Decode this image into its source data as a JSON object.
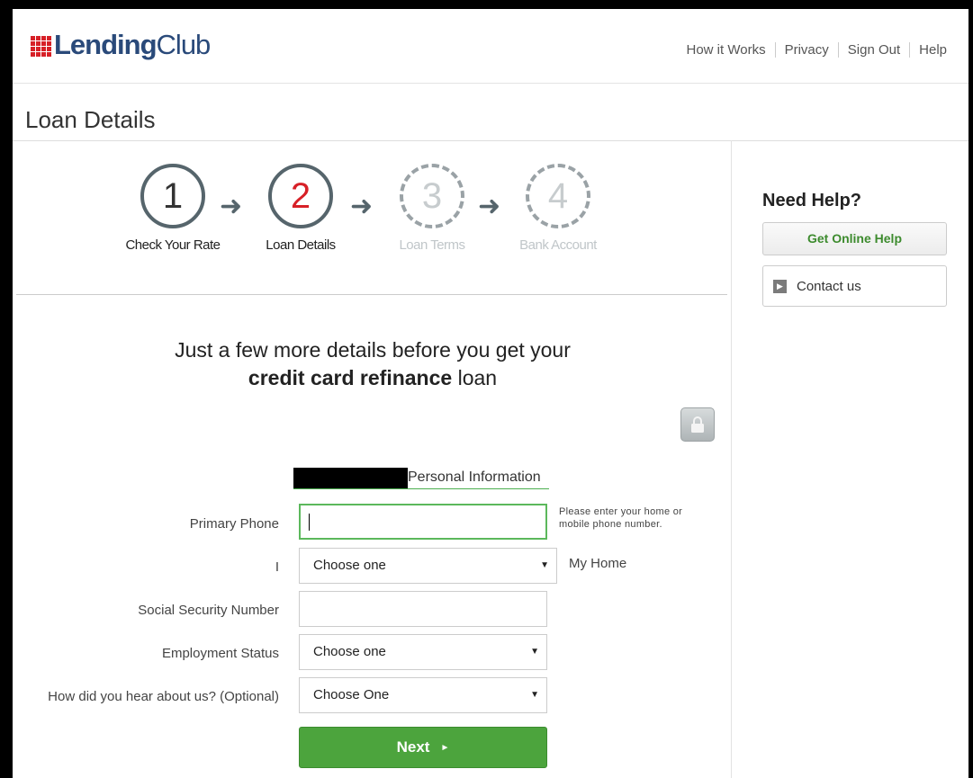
{
  "header": {
    "logo": {
      "part1": "Lending",
      "part2": "Club"
    },
    "nav": [
      "How it Works",
      "Privacy",
      "Sign Out",
      "Help"
    ]
  },
  "page_title": "Loan Details",
  "steps": [
    {
      "number": "1",
      "label": "Check Your Rate",
      "state": "completed"
    },
    {
      "number": "2",
      "label": "Loan Details",
      "state": "active"
    },
    {
      "number": "3",
      "label": "Loan Terms",
      "state": "upcoming"
    },
    {
      "number": "4",
      "label": "Bank Account",
      "state": "upcoming"
    }
  ],
  "intro": {
    "line1": "Just a few more details before you get your",
    "line2_bold": "credit card refinance",
    "line2_rest": " loan"
  },
  "section_title": "Personal Information",
  "form": {
    "primary_phone": {
      "label": "Primary Phone",
      "value": "",
      "hint": "Please enter your home or mobile phone number."
    },
    "phone_type": {
      "label": "I",
      "selected": "Choose one",
      "side_text": "My Home"
    },
    "ssn": {
      "label": "Social Security Number",
      "value": ""
    },
    "employment": {
      "label": "Employment Status",
      "selected": "Choose one"
    },
    "referral": {
      "label": "How did you hear about us? (Optional)",
      "selected": "Choose One"
    },
    "next_label": "Next"
  },
  "sidebar": {
    "heading": "Need Help?",
    "online_help": "Get Online Help",
    "contact": "Contact us"
  },
  "colors": {
    "brand_red": "#d72027",
    "brand_blue": "#2a4a7a",
    "primary_green": "#4ca43d"
  },
  "icons": [
    "lock-icon",
    "dropdown-arrow-icon",
    "step-arrow-icon",
    "contact-arrow-icon",
    "play-triangle-icon"
  ]
}
